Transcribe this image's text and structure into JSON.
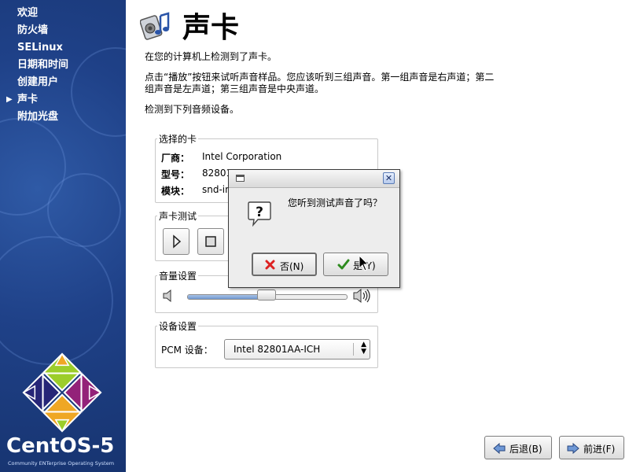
{
  "sidebar": {
    "items": [
      {
        "label": "欢迎"
      },
      {
        "label": "防火墙"
      },
      {
        "label": "SELinux"
      },
      {
        "label": "日期和时间"
      },
      {
        "label": "创建用户"
      },
      {
        "label": "声卡",
        "active": true
      },
      {
        "label": "附加光盘"
      }
    ],
    "brand": "CentOS-5",
    "brand_sub": "Community ENTerprise Operating System"
  },
  "header": {
    "title": "声卡",
    "icon": "sound-card-icon"
  },
  "content": {
    "detected_line": "在您的计算机上检测到了声卡。",
    "instruction_line1": "点击“播放”按钮来试听声音样品。您应该听到三组声音。第一组声音是右声道；第二",
    "instruction_line2": "组声音是左声道；第三组声音是中央声道。",
    "devices_line": "检测到下列音频设备。"
  },
  "selected_card": {
    "label": "选择的卡",
    "vendor_key": "厂商：",
    "vendor_value": "Intel Corporation",
    "model_key": "型号：",
    "model_value": "82801",
    "module_key": "模块：",
    "module_value": "snd-in"
  },
  "test": {
    "label": "声卡测试",
    "play_icon": "play-icon",
    "stop_icon": "stop-icon"
  },
  "volume": {
    "label": "音量设置",
    "level": 0.5
  },
  "device_settings": {
    "label": "设备设置",
    "pcm_label": "PCM 设备：",
    "pcm_value": "Intel 82801AA-ICH"
  },
  "dialog": {
    "message": "您听到测试声音了吗？",
    "no_label": "否(N)",
    "yes_label": "是(Y)"
  },
  "nav_buttons": {
    "back": "后退(B)",
    "next": "前进(F)"
  },
  "colors": {
    "sidebar": "#1f4188",
    "accent": "#3b6ec2"
  }
}
